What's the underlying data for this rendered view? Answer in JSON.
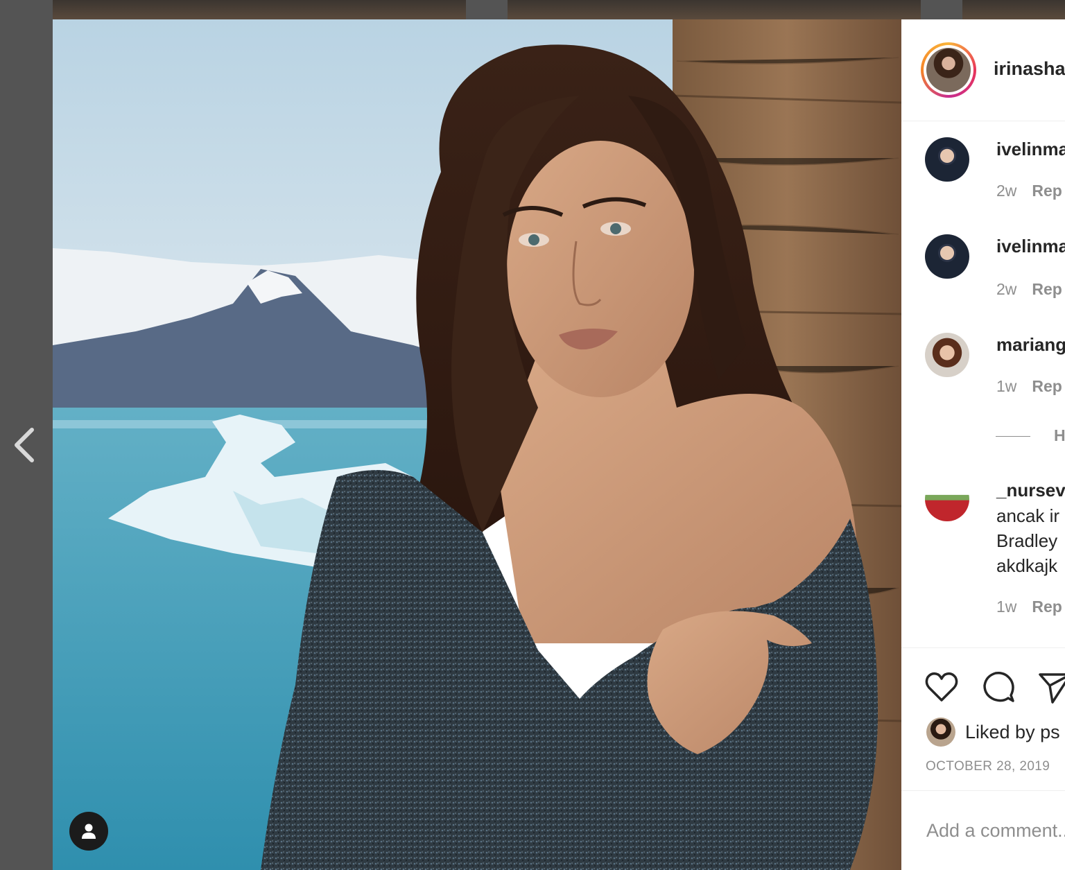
{
  "post": {
    "owner": "irinashay",
    "date": "OCTOBER 28, 2019",
    "likes_text": "Liked by ps"
  },
  "comments": [
    {
      "user": "ivelinma",
      "time": "2w",
      "reply": "Rep"
    },
    {
      "user": "ivelinma",
      "time": "2w",
      "reply": "Rep"
    },
    {
      "user": "mariang",
      "time": "1w",
      "reply": "Rep"
    },
    {
      "user": "_nursev",
      "lines": [
        "ancak ir",
        "Bradley",
        "akdkajk"
      ],
      "time": "1w",
      "reply": "Rep"
    }
  ],
  "hide_replies_label": "H",
  "add_comment": {
    "placeholder": "Add a comment..."
  },
  "icons": {
    "nav_prev": "chevron-left-icon",
    "tag": "user-tag-icon",
    "like": "heart-icon",
    "comment": "comment-icon",
    "share": "share-icon"
  },
  "colors": {
    "text": "#262626",
    "muted": "#8e8e8e",
    "border": "#efefef",
    "backdrop": "#545454"
  }
}
